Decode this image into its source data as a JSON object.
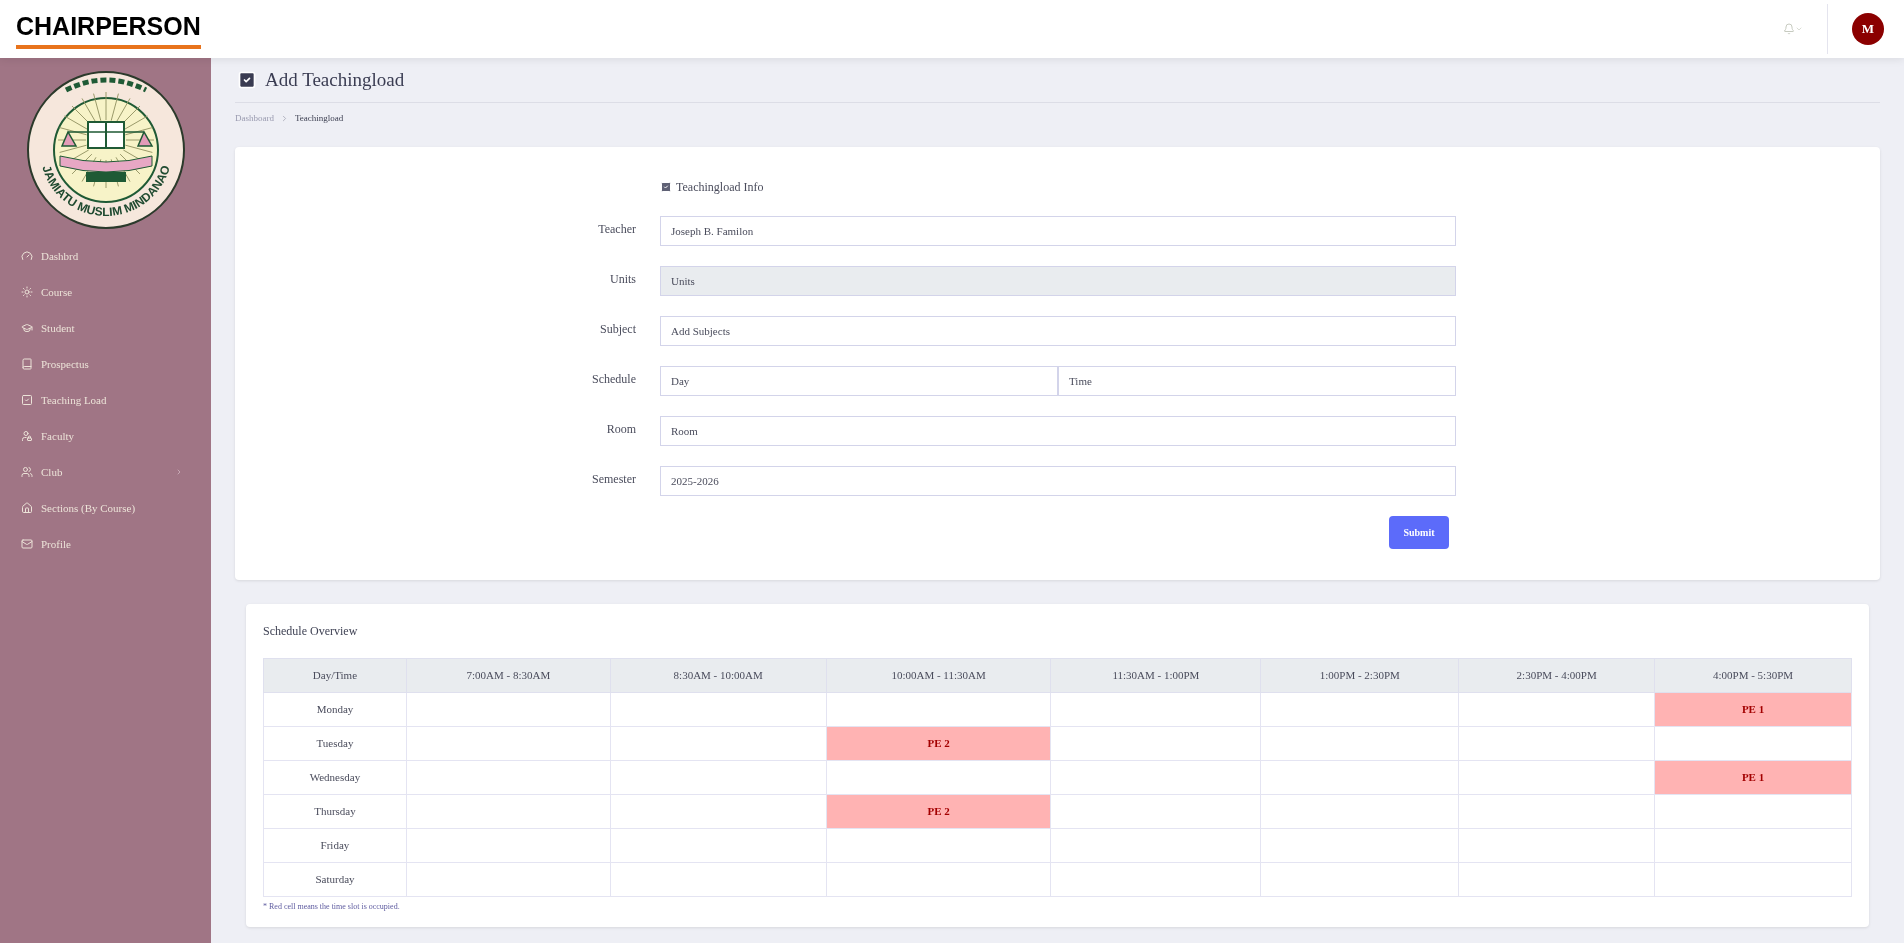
{
  "header": {
    "title": "CHAIRPERSON",
    "avatar": "M"
  },
  "sidebar": {
    "logo_text": "JAMIATU MUSLIM MINDANAO",
    "items": [
      {
        "label": "Dashbrd",
        "has_submenu": false
      },
      {
        "label": "Course",
        "has_submenu": false
      },
      {
        "label": "Student",
        "has_submenu": false
      },
      {
        "label": "Prospectus",
        "has_submenu": false
      },
      {
        "label": "Teaching Load",
        "has_submenu": false
      },
      {
        "label": "Faculty",
        "has_submenu": false
      },
      {
        "label": "Club",
        "has_submenu": true
      },
      {
        "label": "Sections (By Course)",
        "has_submenu": false
      },
      {
        "label": "Profile",
        "has_submenu": false
      }
    ]
  },
  "page": {
    "title": "Add Teachingload",
    "breadcrumb": [
      "Dashboard",
      "Teachingload"
    ]
  },
  "form": {
    "section": "Teachingload Info",
    "fields": [
      {
        "label": "Teacher",
        "inputs": [
          {
            "value": "Joseph B. Familon",
            "disabled": false
          }
        ]
      },
      {
        "label": "Units",
        "inputs": [
          {
            "placeholder": "Units",
            "disabled": true
          }
        ]
      },
      {
        "label": "Subject",
        "inputs": [
          {
            "placeholder": "Add Subjects",
            "disabled": false
          }
        ]
      },
      {
        "label": "Schedule",
        "inputs": [
          {
            "placeholder": "Day",
            "disabled": false
          },
          {
            "placeholder": "Time",
            "disabled": false
          }
        ]
      },
      {
        "label": "Room",
        "inputs": [
          {
            "placeholder": "Room",
            "disabled": false
          }
        ]
      },
      {
        "label": "Semester",
        "inputs": [
          {
            "value": "2025-2026",
            "disabled": false
          }
        ]
      }
    ],
    "submit": "Submit"
  },
  "schedule": {
    "title": "Schedule Overview",
    "columns": [
      "Day/Time",
      "7:00AM - 8:30AM",
      "8:30AM - 10:00AM",
      "10:00AM - 11:30AM",
      "11:30AM - 1:00PM",
      "1:00PM - 2:30PM",
      "2:30PM - 4:00PM",
      "4:00PM - 5:30PM"
    ],
    "rows": [
      {
        "day": "Monday",
        "cells": [
          {
            "occupied": false
          },
          {
            "occupied": false
          },
          {
            "occupied": false
          },
          {
            "occupied": false
          },
          {
            "occupied": false
          },
          {
            "occupied": false
          },
          {
            "occupied": true,
            "text": "PE 1"
          }
        ]
      },
      {
        "day": "Tuesday",
        "cells": [
          {
            "occupied": false
          },
          {
            "occupied": false
          },
          {
            "occupied": true,
            "text": "PE 2"
          },
          {
            "occupied": false
          },
          {
            "occupied": false
          },
          {
            "occupied": false
          },
          {
            "occupied": false
          }
        ]
      },
      {
        "day": "Wednesday",
        "cells": [
          {
            "occupied": false
          },
          {
            "occupied": false
          },
          {
            "occupied": false
          },
          {
            "occupied": false
          },
          {
            "occupied": false
          },
          {
            "occupied": false
          },
          {
            "occupied": true,
            "text": "PE 1"
          }
        ]
      },
      {
        "day": "Thursday",
        "cells": [
          {
            "occupied": false
          },
          {
            "occupied": false
          },
          {
            "occupied": true,
            "text": "PE 2"
          },
          {
            "occupied": false
          },
          {
            "occupied": false
          },
          {
            "occupied": false
          },
          {
            "occupied": false
          }
        ]
      },
      {
        "day": "Friday",
        "cells": [
          {
            "occupied": false
          },
          {
            "occupied": false
          },
          {
            "occupied": false
          },
          {
            "occupied": false
          },
          {
            "occupied": false
          },
          {
            "occupied": false
          },
          {
            "occupied": false
          }
        ]
      },
      {
        "day": "Saturday",
        "cells": [
          {
            "occupied": false
          },
          {
            "occupied": false
          },
          {
            "occupied": false
          },
          {
            "occupied": false
          },
          {
            "occupied": false
          },
          {
            "occupied": false
          },
          {
            "occupied": false
          }
        ]
      }
    ],
    "note": "* Red cell means the time slot is occupied."
  }
}
